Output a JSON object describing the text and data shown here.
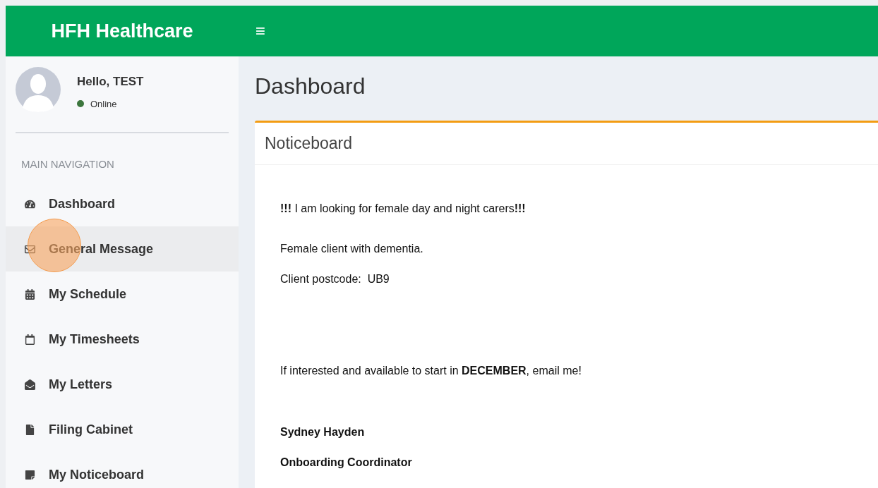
{
  "header": {
    "logo": "HFH Healthcare",
    "menu_toggle": "≡"
  },
  "user_panel": {
    "greeting": "Hello, TEST",
    "status": "Online",
    "online": true
  },
  "sidebar": {
    "section_title": "MAIN NAVIGATION",
    "items": [
      {
        "label": "Dashboard",
        "selected": false
      },
      {
        "label": "General Message",
        "selected": true
      },
      {
        "label": "My Schedule",
        "selected": false
      },
      {
        "label": "My Timesheets",
        "selected": false
      },
      {
        "label": "My Letters",
        "selected": false
      },
      {
        "label": "Filing Cabinet",
        "selected": false
      },
      {
        "label": "My Noticeboard",
        "selected": false
      }
    ]
  },
  "page_title": "Dashboard",
  "noticeboard": {
    "title": "Noticeboard",
    "paragraphs": [
      {
        "kind": "text",
        "text": "**!!!** I am looking for female day and night carers**!!!**"
      },
      {
        "kind": "text",
        "text": "Female client with dementia."
      },
      {
        "kind": "text",
        "text": "Client postcode:  UB9"
      },
      {
        "kind": "text",
        "text": "If interested and available to start in **DECEMBER**, email me!"
      },
      {
        "kind": "bold",
        "text": "Sydney Hayden"
      },
      {
        "kind": "bold",
        "text": "Onboarding Coordinator"
      }
    ]
  }
}
